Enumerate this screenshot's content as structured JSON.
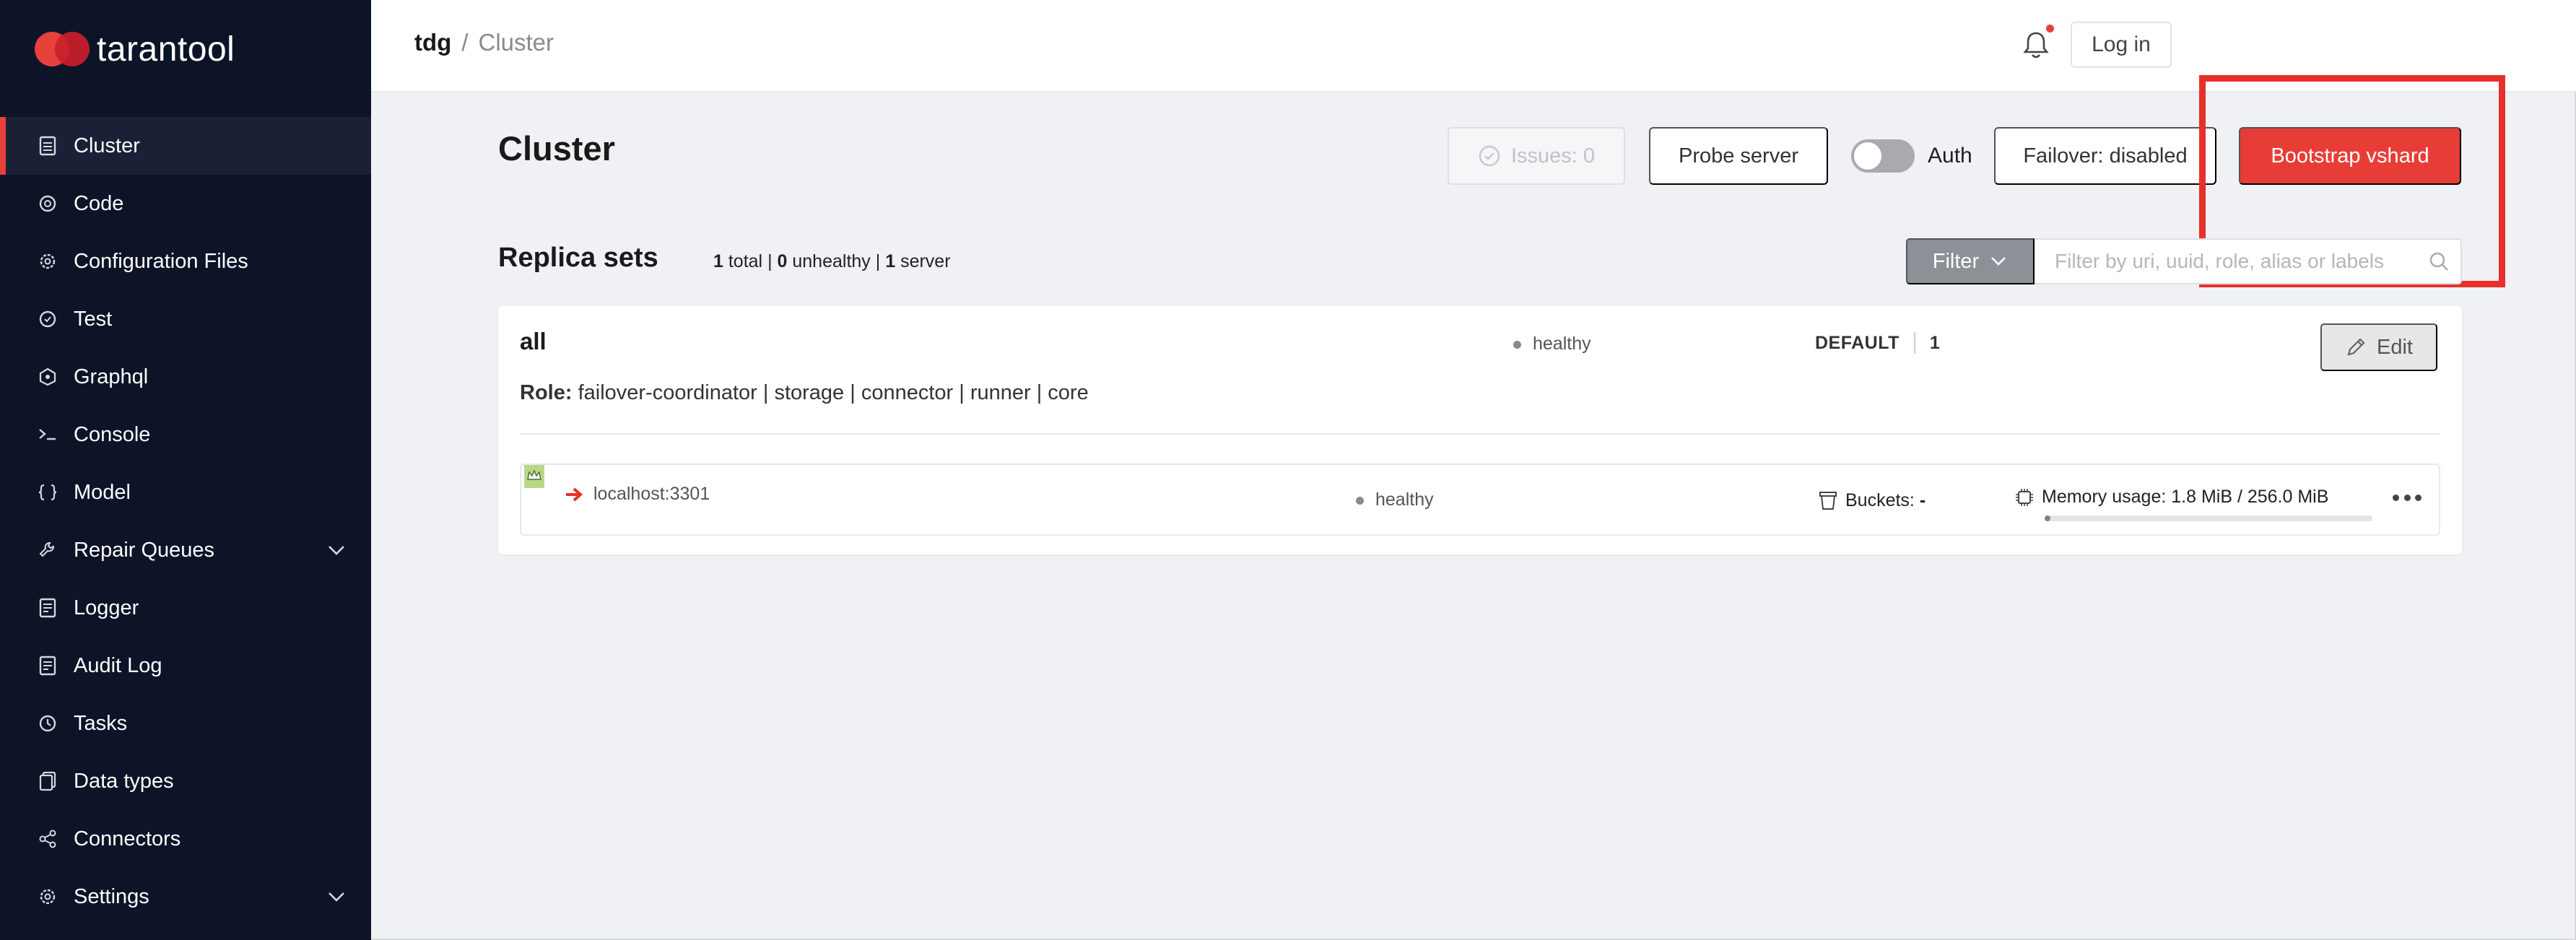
{
  "app": {
    "name": "tarantool"
  },
  "sidebar": {
    "items": [
      {
        "label": "Cluster",
        "icon": "cluster-icon",
        "active": true
      },
      {
        "label": "Code",
        "icon": "code-icon"
      },
      {
        "label": "Configuration Files",
        "icon": "gear-icon"
      },
      {
        "label": "Test",
        "icon": "test-icon"
      },
      {
        "label": "Graphql",
        "icon": "graphql-icon"
      },
      {
        "label": "Console",
        "icon": "console-icon"
      },
      {
        "label": "Model",
        "icon": "braces-icon"
      },
      {
        "label": "Repair Queues",
        "icon": "wrench-icon",
        "expandable": true
      },
      {
        "label": "Logger",
        "icon": "document-icon"
      },
      {
        "label": "Audit Log",
        "icon": "document-icon"
      },
      {
        "label": "Tasks",
        "icon": "clock-icon"
      },
      {
        "label": "Data types",
        "icon": "files-icon"
      },
      {
        "label": "Connectors",
        "icon": "share-icon"
      },
      {
        "label": "Settings",
        "icon": "gear-icon",
        "expandable": true
      }
    ]
  },
  "header": {
    "breadcrumb_root": "tdg",
    "breadcrumb_sep": "/",
    "breadcrumb_current": "Cluster",
    "login_label": "Log in"
  },
  "main": {
    "title": "Cluster",
    "toolbar": {
      "issues_label": "Issues: 0",
      "probe_label": "Probe server",
      "auth_label": "Auth",
      "auth_enabled": false,
      "failover_label": "Failover: disabled",
      "bootstrap_label": "Bootstrap vshard"
    },
    "replica_sets": {
      "title": "Replica sets",
      "total": "1",
      "total_label": "total",
      "unhealthy": "0",
      "unhealthy_label": "unhealthy",
      "servers": "1",
      "servers_label": "server",
      "filter_label": "Filter",
      "filter_placeholder": "Filter by uri, uuid, role, alias or labels"
    },
    "replica_set": {
      "name": "all",
      "status": "healthy",
      "group": "DEFAULT",
      "weight": "1",
      "edit_label": "Edit",
      "role_label": "Role:",
      "roles": "failover-coordinator | storage | connector | runner | core",
      "server": {
        "uri": "localhost:3301",
        "status": "healthy",
        "buckets_label": "Buckets:",
        "buckets_value": "-",
        "memory_label": "Memory usage:",
        "memory_value": "1.8 MiB / 256.0 MiB",
        "memory_fraction": 0.007
      }
    }
  },
  "colors": {
    "sidebar_bg": "#0d1428",
    "accent": "#e83d37",
    "page_bg": "#f0f1f5"
  }
}
